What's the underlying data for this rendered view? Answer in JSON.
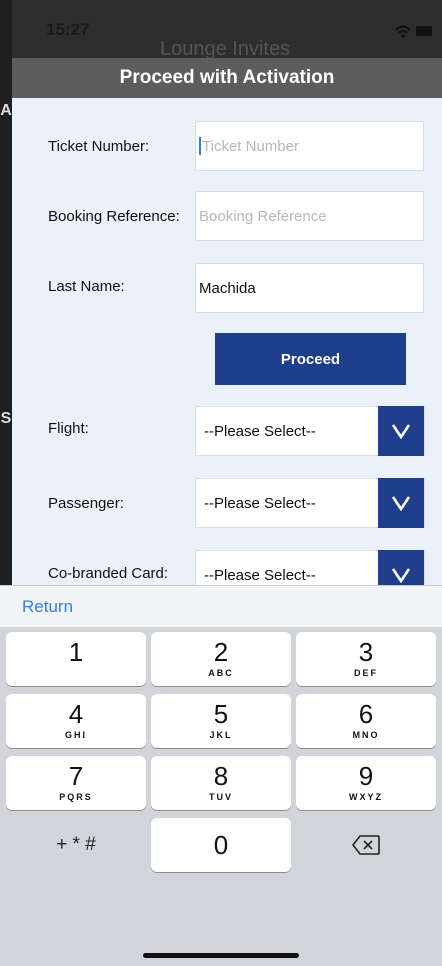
{
  "status_bar": {
    "time": "15:27"
  },
  "background": {
    "title": "Lounge Invites",
    "side_letters": [
      "A",
      "S"
    ]
  },
  "modal": {
    "title": "Proceed with Activation",
    "ticket": {
      "label": "Ticket Number:",
      "placeholder": "Ticket Number",
      "value": ""
    },
    "booking": {
      "label": "Booking Reference:",
      "placeholder": "Booking Reference",
      "value": ""
    },
    "lastname": {
      "label": "Last Name:",
      "placeholder": "",
      "value": "Machida"
    },
    "proceed_label": "Proceed",
    "flight": {
      "label": "Flight:",
      "selected": "--Please Select--"
    },
    "passenger": {
      "label": "Passenger:",
      "selected": "--Please Select--"
    },
    "cobranded": {
      "label": "Co-branded Card:",
      "selected": "--Please Select--"
    }
  },
  "keyboard": {
    "return_label": "Return",
    "keys": [
      {
        "num": "1",
        "letters": ""
      },
      {
        "num": "2",
        "letters": "ABC"
      },
      {
        "num": "3",
        "letters": "DEF"
      },
      {
        "num": "4",
        "letters": "GHI"
      },
      {
        "num": "5",
        "letters": "JKL"
      },
      {
        "num": "6",
        "letters": "MNO"
      },
      {
        "num": "7",
        "letters": "PQRS"
      },
      {
        "num": "8",
        "letters": "TUV"
      },
      {
        "num": "9",
        "letters": "WXYZ"
      }
    ],
    "symbols_label": "+ * #",
    "zero": "0"
  },
  "colors": {
    "accent": "#1f3f8c",
    "return_link": "#2f7cf6",
    "header": "#5d5d5d",
    "modal_bg": "#eaf1f8"
  }
}
